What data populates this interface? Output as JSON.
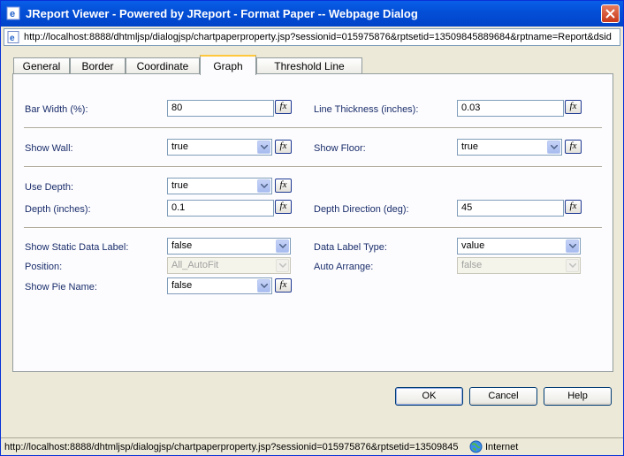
{
  "window": {
    "title": "JReport Viewer - Powered by JReport - Format Paper -- Webpage Dialog",
    "address": "http://localhost:8888/dhtmljsp/dialogjsp/chartpaperproperty.jsp?sessionid=015975876&rptsetid=13509845889684&rptname=Report&dsid"
  },
  "tabs": [
    {
      "label": "General"
    },
    {
      "label": "Border"
    },
    {
      "label": "Coordinate"
    },
    {
      "label": "Graph"
    },
    {
      "label": "Threshold Line"
    }
  ],
  "active_tab": "Graph",
  "form": {
    "bar_width": {
      "label": "Bar Width (%):",
      "value": "80"
    },
    "line_thickness": {
      "label": "Line Thickness (inches):",
      "value": "0.03"
    },
    "show_wall": {
      "label": "Show Wall:",
      "value": "true"
    },
    "show_floor": {
      "label": "Show Floor:",
      "value": "true"
    },
    "use_depth": {
      "label": "Use Depth:",
      "value": "true"
    },
    "depth": {
      "label": "Depth (inches):",
      "value": "0.1"
    },
    "depth_direction": {
      "label": "Depth Direction (deg):",
      "value": "45"
    },
    "show_static_data_label": {
      "label": "Show Static Data Label:",
      "value": "false"
    },
    "data_label_type": {
      "label": "Data Label Type:",
      "value": "value"
    },
    "position": {
      "label": "Position:",
      "value": "All_AutoFit"
    },
    "auto_arrange": {
      "label": "Auto Arrange:",
      "value": "false"
    },
    "show_pie_name": {
      "label": "Show Pie Name:",
      "value": "false"
    },
    "fx_label": "fx"
  },
  "buttons": {
    "ok": "OK",
    "cancel": "Cancel",
    "help": "Help"
  },
  "status": {
    "url": "http://localhost:8888/dhtmljsp/dialogjsp/chartpaperproperty.jsp?sessionid=015975876&rptsetid=13509845",
    "zone": "Internet"
  },
  "colors": {
    "title_bar": "#0450d8",
    "label_text": "#1a2d6b",
    "active_tab_accent": "#ffc83c"
  }
}
